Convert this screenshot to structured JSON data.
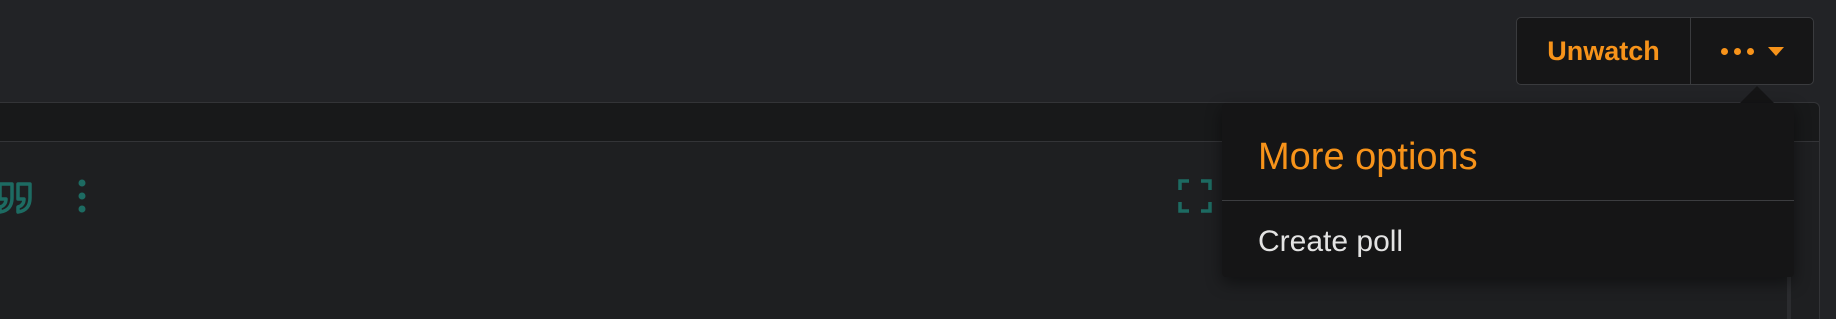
{
  "toolbar": {
    "unwatch_label": "Unwatch",
    "more_icon": "ellipsis-icon",
    "more_caret_icon": "caret-down-icon"
  },
  "editor": {
    "quote_icon": "quote-icon",
    "overflow_icon": "kebab-icon",
    "fullscreen_icon": "fullscreen-icon"
  },
  "dropdown": {
    "title": "More options",
    "items": [
      {
        "label": "Create poll"
      }
    ]
  },
  "colors": {
    "accent": "#f7931a",
    "background": "#222326",
    "panel": "#151516",
    "icon_teal": "#1d6b62",
    "text": "#e3e3e3"
  }
}
